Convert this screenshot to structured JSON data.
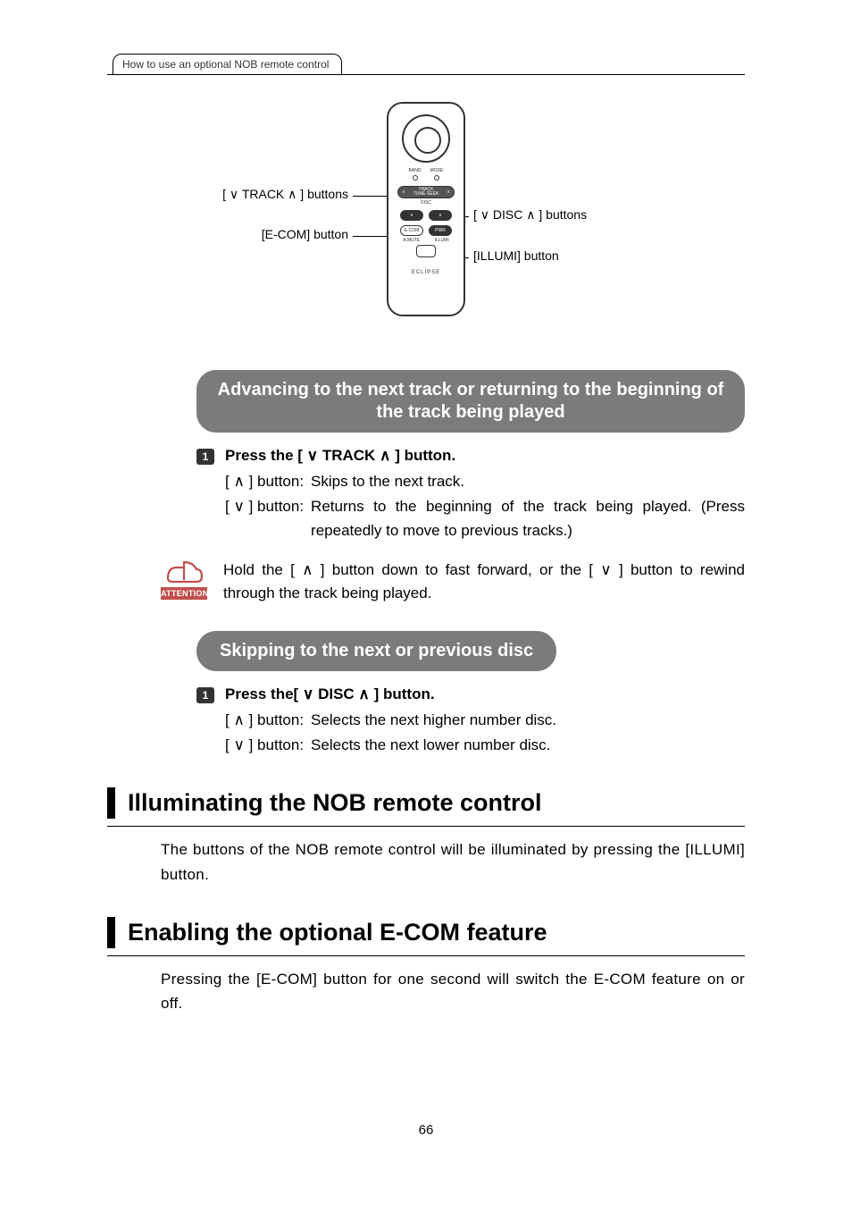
{
  "header": {
    "tab": "How to use an optional NOB remote control"
  },
  "callouts": {
    "track_buttons": "[ ∨ TRACK ∧ ] buttons",
    "ecom_button": "[E-COM] button",
    "disc_buttons": "[ ∨ DISC ∧ ] buttons",
    "illumi_button": "[ILLUMI] button"
  },
  "remote_labels": {
    "band": "BAND",
    "mode": "MODE",
    "track": "TRACK",
    "tune": "TUNE·SEEK",
    "disc": "DISC",
    "ecom": "E·COM",
    "pwr": "PWR",
    "mute": "A.MUTE",
    "illumi": "ILLUMI",
    "brand": "ECLIPSE"
  },
  "section_track": {
    "title": "Advancing to the next track or returning to the beginning of the track being played",
    "step1": "Press the [ ∨ TRACK ∧ ] button.",
    "up_label": "[ ∧ ] button:",
    "up_text": "Skips to the next track.",
    "down_label": "[ ∨ ] button:",
    "down_text": "Returns to the beginning of the track being played. (Press repeatedly to move to previous tracks.)"
  },
  "attention": {
    "label": "ATTENTION",
    "text": "Hold the [ ∧ ] button down to fast forward, or the [ ∨ ] button to rewind through the track being played."
  },
  "section_disc": {
    "title": "Skipping to the next or previous disc",
    "step1": "Press the[ ∨ DISC ∧ ] button.",
    "up_label": "[ ∧ ] button:",
    "up_text": "Selects the next higher number disc.",
    "down_label": "[ ∨ ] button:",
    "down_text": "Selects the next lower number disc."
  },
  "section_illum": {
    "title": "Illuminating the NOB remote control",
    "body": "The buttons of the NOB remote control will be illuminated by pressing the [ILLUMI] button."
  },
  "section_ecom": {
    "title": "Enabling the optional E-COM feature",
    "body": "Pressing the [E-COM] button for one second will switch the E-COM feature on or off."
  },
  "page_number": "66"
}
